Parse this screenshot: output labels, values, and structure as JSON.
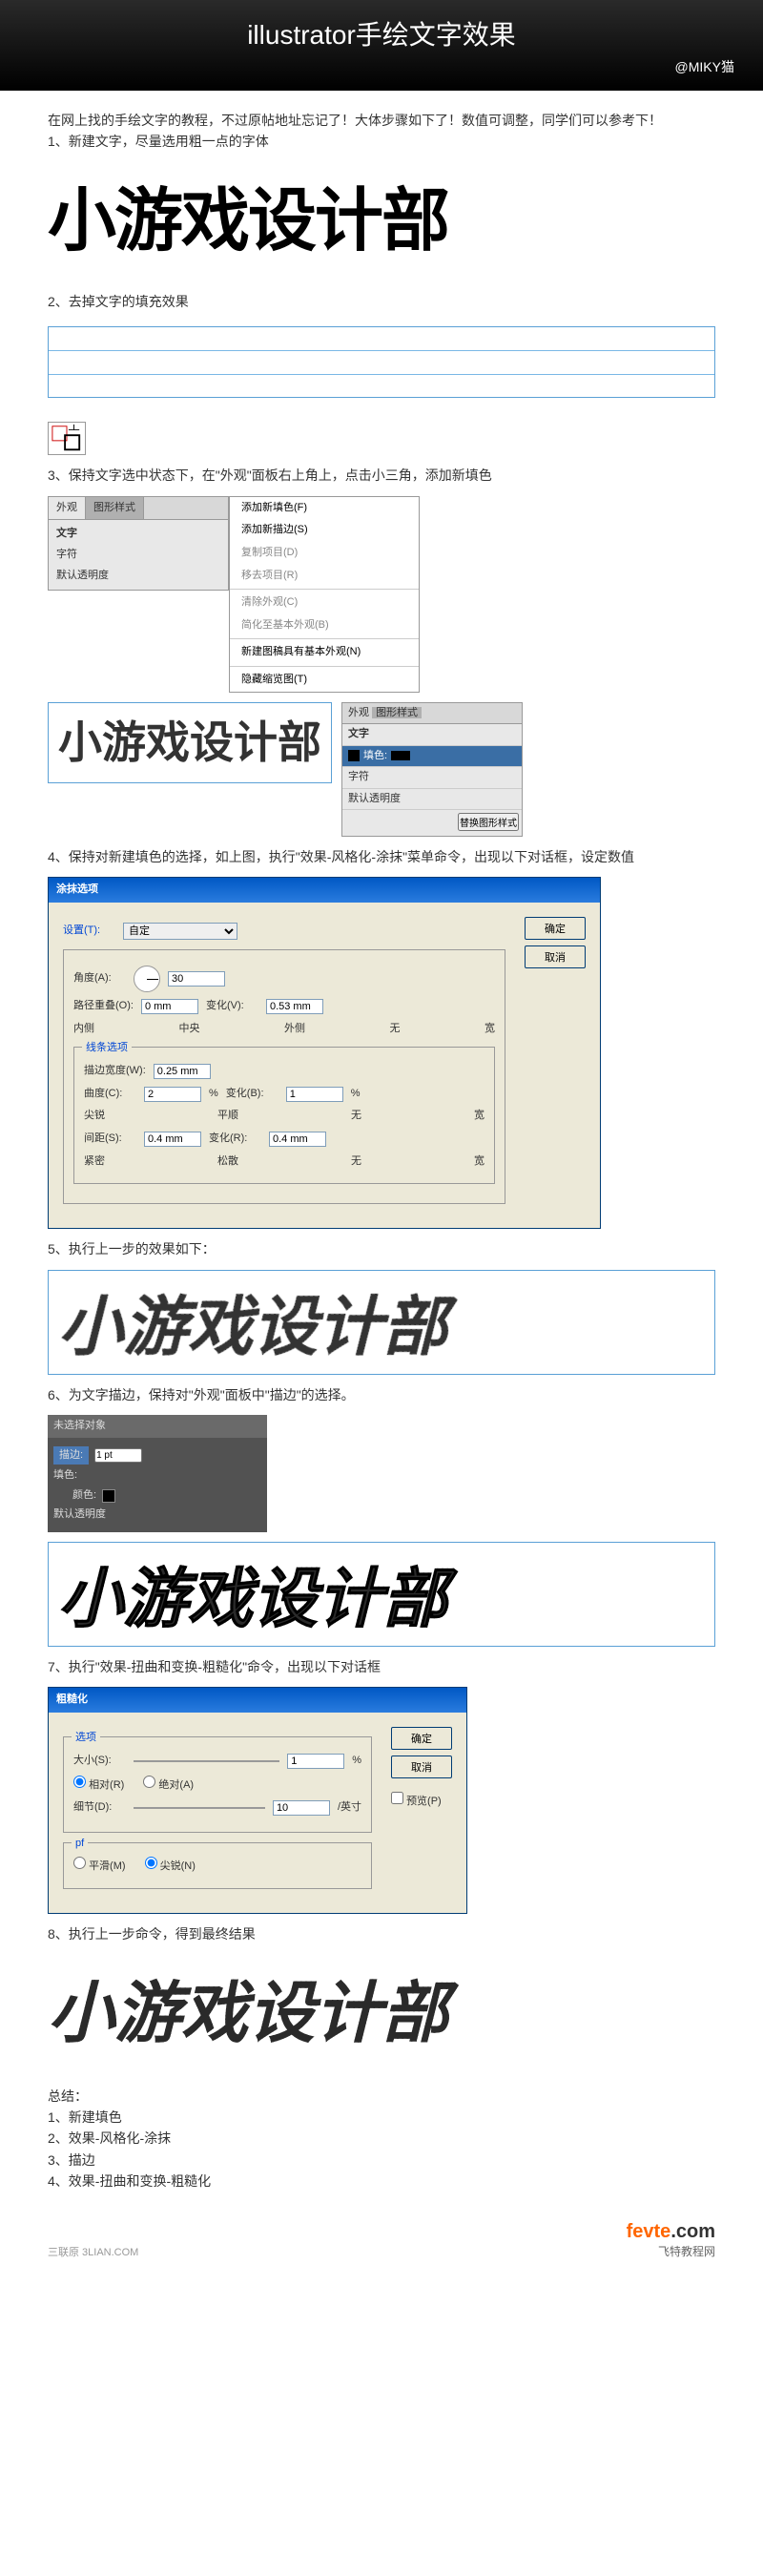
{
  "header": {
    "title": "illustrator手绘文字效果",
    "credit": "@MIKY猫"
  },
  "intro": "在网上找的手绘文字的教程，不过原帖地址忘记了！大体步骤如下了！数值可调整，同学们可以参考下！",
  "step1": {
    "label": "1、新建文字，尽量选用粗一点的字体",
    "text": "小游戏设计部"
  },
  "step2": {
    "label": "2、去掉文字的填充效果"
  },
  "step3": {
    "label": "3、保持文字选中状态下，在\"外观\"面板右上角上，点击小三角，添加新填色",
    "panel": {
      "tab1": "外观",
      "tab2": "图形样式",
      "item1": "文字",
      "item2": "字符",
      "item3": "默认透明度"
    },
    "menu": {
      "m1": "添加新填色(F)",
      "m2": "添加新描边(S)",
      "m3": "复制项目(D)",
      "m4": "移去项目(R)",
      "m5": "清除外观(C)",
      "m6": "简化至基本外观(B)",
      "m7": "新建图稿具有基本外观(N)",
      "m8": "隐藏缩览图(T)"
    },
    "text": "小游戏设计部",
    "rpanel": {
      "tab1": "外观",
      "tab2": "图形样式",
      "r1": "文字",
      "r2": "填色:",
      "r3": "字符",
      "r4": "默认透明度",
      "btn": "替换图形样式"
    }
  },
  "step4": {
    "label": "4、保持对新建填色的选择，如上图，执行\"效果-风格化-涂抹\"菜单命令，出现以下对话框，设定数值",
    "dialog": {
      "title": "涂抹选项",
      "setting": "设置(T):",
      "setting_val": "自定",
      "angle": "角度(A):",
      "angle_val": "30",
      "offset": "路径重叠(O):",
      "offset_val": "0 mm",
      "offset_var": "变化(V):",
      "offset_var_val": "0.53 mm",
      "offset_l": "内侧",
      "offset_c": "中央",
      "offset_r": "外侧",
      "var_l": "无",
      "var_r": "宽",
      "line_opt": "线条选项",
      "width": "描边宽度(W):",
      "width_val": "0.25 mm",
      "curve": "曲度(C):",
      "curve_val": "2",
      "curve_unit": "%",
      "curve_var": "变化(B):",
      "curve_var_val": "1",
      "curve_var_unit": "%",
      "curve_l": "尖锐",
      "curve_c": "平顺",
      "curve_r": "无",
      "cvar_r": "宽",
      "space": "间距(S):",
      "space_val": "0.4 mm",
      "space_var": "变化(R):",
      "space_var_val": "0.4 mm",
      "space_l": "紧密",
      "space_c": "松散",
      "space_r": "无",
      "svar_r": "宽",
      "ok": "确定",
      "cancel": "取消"
    }
  },
  "step5": {
    "label": "5、执行上一步的效果如下：",
    "text": "小游戏设计部"
  },
  "step6": {
    "label": "6、为文字描边，保持对\"外观\"面板中\"描边\"的选择。",
    "panel": {
      "title": "未选择对象",
      "stroke": "描边:",
      "stroke_val": "1 pt",
      "fill": "填色:",
      "color": "颜色:",
      "opacity": "默认透明度"
    },
    "text": "小游戏设计部"
  },
  "step7": {
    "label": "7、执行\"效果-扭曲和变换-粗糙化\"命令，出现以下对话框",
    "dialog": {
      "title": "粗糙化",
      "options": "选项",
      "size": "大小(S):",
      "size_val": "1",
      "size_unit": "%",
      "rel": "相对(R)",
      "abs": "绝对(A)",
      "detail": "细节(D):",
      "detail_val": "10",
      "detail_unit": "/英寸",
      "pt": "pf",
      "smooth": "平滑(M)",
      "corner": "尖锐(N)",
      "ok": "确定",
      "cancel": "取消",
      "preview": "预览(P)"
    }
  },
  "step8": {
    "label": "8、执行上一步命令，得到最终结果",
    "text": "小游戏设计部"
  },
  "summary": {
    "title": "总结：",
    "s1": "1、新建填色",
    "s2": "2、效果-风格化-涂抹",
    "s3": "3、描边",
    "s4": "4、效果-扭曲和变换-粗糙化"
  },
  "footer": {
    "left": "三联原 3LIAN.COM",
    "brand": "fevte",
    "brand_suffix": ".com",
    "sub": "飞特教程网"
  }
}
